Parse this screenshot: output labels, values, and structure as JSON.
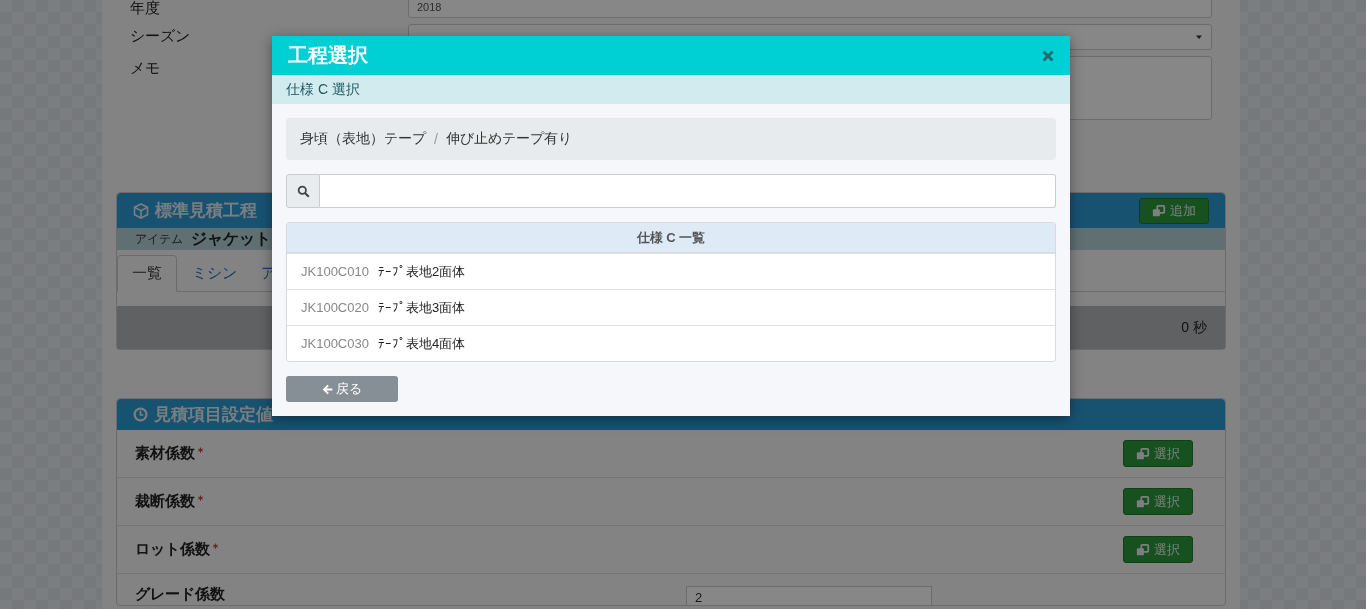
{
  "background_form": {
    "fields": [
      {
        "label": "年度",
        "kind": "text",
        "value": "2018"
      },
      {
        "label": "シーズン",
        "kind": "select"
      },
      {
        "label": "メモ",
        "kind": "textarea"
      }
    ]
  },
  "process_panel": {
    "title": "標準見積工程",
    "add_button": "追加",
    "item_label": "アイテム",
    "item_value": "ジャケット",
    "tabs": [
      {
        "label": "一覧",
        "selected": true
      },
      {
        "label": "ミシン",
        "selected": false
      },
      {
        "label": "ア",
        "selected": false
      }
    ],
    "total": "0 秒"
  },
  "settings_panel": {
    "title": "見積項目設定値",
    "rows": [
      {
        "label": "素材係数",
        "required": true,
        "kind": "button",
        "button": "選択"
      },
      {
        "label": "裁断係数",
        "required": true,
        "kind": "button",
        "button": "選択"
      },
      {
        "label": "ロット係数",
        "required": true,
        "kind": "button",
        "button": "選択"
      },
      {
        "label": "グレード係数",
        "required": false,
        "kind": "input",
        "value": "2"
      }
    ]
  },
  "modal": {
    "title": "工程選択",
    "subtitle": "仕様 C 選択",
    "breadcrumb": {
      "items": [
        "身頃（表地）テープ",
        "伸び止めテープ有り"
      ],
      "separator": "/"
    },
    "list": {
      "header": "仕様 C 一覧",
      "items": [
        {
          "code": "JK100C010",
          "name": "ﾃｰﾌﾟ表地2面体"
        },
        {
          "code": "JK100C020",
          "name": "ﾃｰﾌﾟ表地3面体"
        },
        {
          "code": "JK100C030",
          "name": "ﾃｰﾌﾟ表地4面体"
        }
      ]
    },
    "back_button": "戻る"
  }
}
